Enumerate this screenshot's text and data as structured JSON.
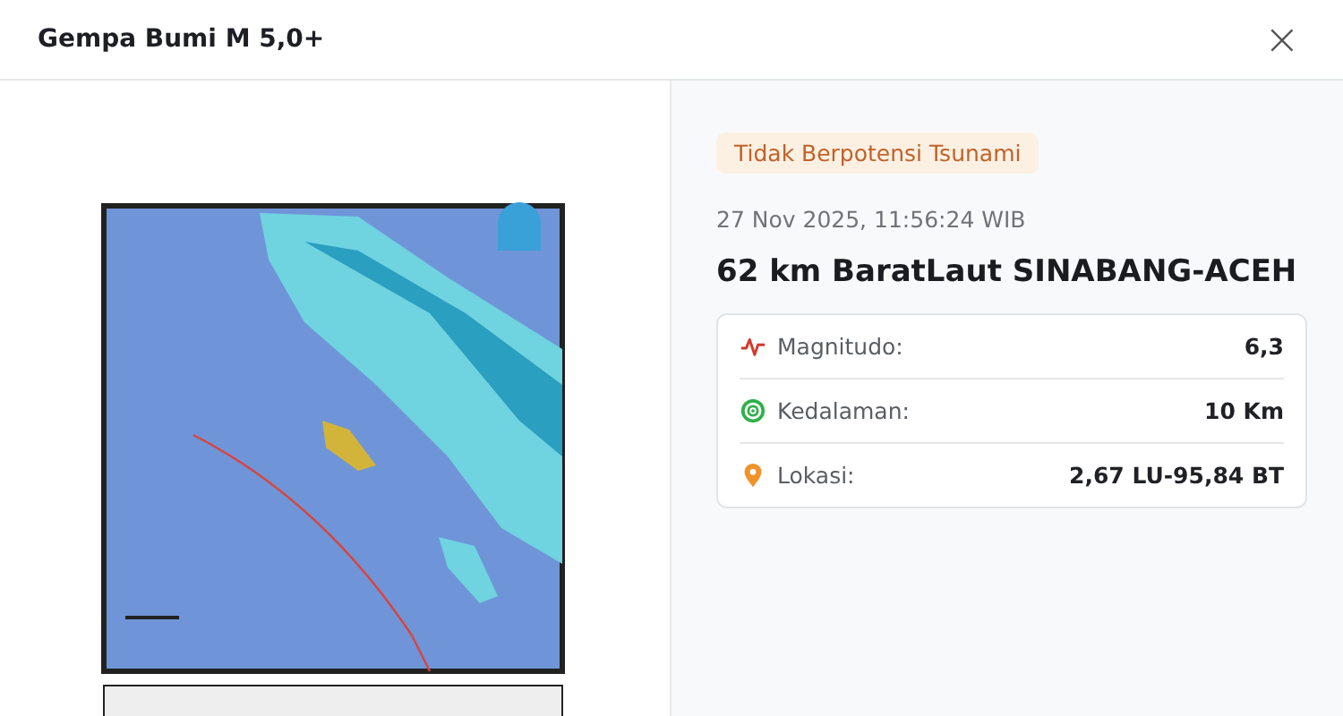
{
  "dialog": {
    "title": "Gempa Bumi M 5,0+",
    "close": "×"
  },
  "details": {
    "badge": "Tidak Berpotensi Tsunami",
    "datetime": "27 Nov 2025, 11:56:24 WIB",
    "location_title": "62 km BaratLaut SINABANG-ACEH",
    "rows": [
      {
        "kind": "magnitude",
        "label": "Magnitudo:",
        "value": "6,3"
      },
      {
        "kind": "depth",
        "label": "Kedalaman:",
        "value": "10 Km"
      },
      {
        "kind": "location",
        "label": "Lokasi:",
        "value": "2,67 LU-95,84 BT"
      }
    ]
  }
}
